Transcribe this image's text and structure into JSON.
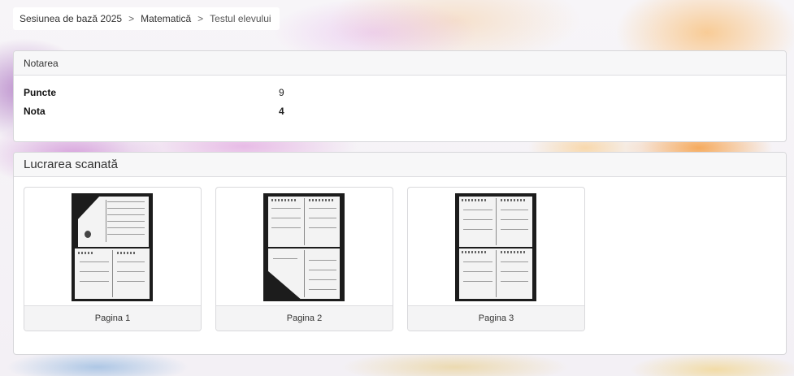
{
  "breadcrumb": {
    "items": [
      "Sesiunea de bază 2025",
      "Matematică",
      "Testul elevului"
    ],
    "separator": ">"
  },
  "grading": {
    "title": "Notarea",
    "rows": [
      {
        "label": "Puncte",
        "value": "9"
      },
      {
        "label": "Nota",
        "value": "4"
      }
    ]
  },
  "scanned": {
    "title": "Lucrarea scanată",
    "pages": [
      {
        "caption": "Pagina 1"
      },
      {
        "caption": "Pagina 2"
      },
      {
        "caption": "Pagina 3"
      }
    ]
  }
}
